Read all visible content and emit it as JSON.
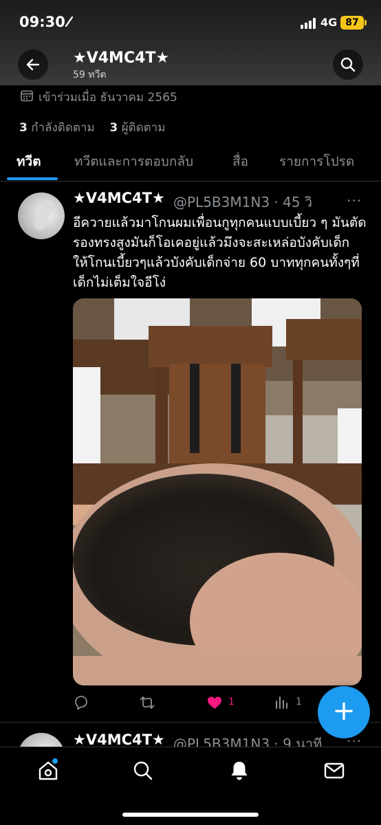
{
  "status_bar": {
    "time": "09:30",
    "network": "4G",
    "battery": "87"
  },
  "header": {
    "title": "★V4MC4T★",
    "subtitle": "59 ทวีต"
  },
  "profile": {
    "joined": "เข้าร่วมเมื่อ ธันวาคม 2565",
    "following_count": "3",
    "following_label": "กำลังติดตาม",
    "followers_count": "3",
    "followers_label": "ผู้ติดตาม"
  },
  "tabs": [
    {
      "label": "ทวีต",
      "active": true
    },
    {
      "label": "ทวีตและการตอบกลับ",
      "active": false
    },
    {
      "label": "สื่อ",
      "active": false
    },
    {
      "label": "รายการโปรด",
      "active": false
    }
  ],
  "tweets": [
    {
      "name": "★V4MC4T★",
      "handle": "@PL5B3M1N3 · 45 วิ",
      "more": "···",
      "text": "อีควายแล้วมาโกนผมเพื่อนกูทุกคนแบบเบี้ยว ๆ มันตัดรองทรงสูงมันก็โอเคอยู่แล้วมึงจะสะเหล่อบังคับเด็ก ให้โกนเบี้ยวๆแล้วบังคับเด็กจ่าย 60 บาททุกคนทั้งๆที่เด็กไม่เต็มใจอีโง่",
      "likes": "1",
      "views": "1"
    },
    {
      "name": "★V4MC4T★",
      "handle": "@PL5B3M1N3 · 9 นาที",
      "more": "···"
    }
  ],
  "fab": {
    "label": "+"
  },
  "colors": {
    "accent": "#1d9bf0",
    "like": "#f91880",
    "battery": "#f5c518",
    "muted": "#8b9095"
  },
  "icons": [
    "back-arrow-icon",
    "search-icon",
    "calendar-icon",
    "reply-icon",
    "retweet-icon",
    "heart-icon",
    "views-icon",
    "home-icon",
    "explore-icon",
    "bell-icon",
    "mail-icon"
  ]
}
